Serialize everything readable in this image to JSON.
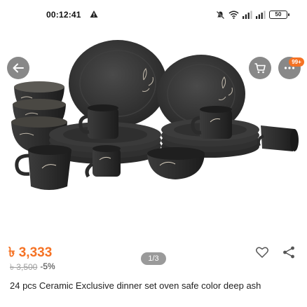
{
  "status_bar": {
    "time": "00:12:41",
    "battery": "50",
    "icons": [
      "warning-icon",
      "mute-icon",
      "wifi-icon",
      "signal-icon",
      "signal-icon",
      "battery-icon"
    ]
  },
  "top_nav": {
    "back_icon": "arrow-left-icon",
    "cart_icon": "cart-icon",
    "more_icon": "more-icon",
    "badge": "99+"
  },
  "gallery": {
    "pager": "1/3"
  },
  "product": {
    "price": "৳ 3,333",
    "original_price": "৳ 3,500",
    "discount": "-5%",
    "title": "24 pcs Ceramic Exclusive  dinner set oven safe color deep ash"
  },
  "actions": {
    "wishlist_icon": "heart-icon",
    "share_icon": "share-icon"
  },
  "colors": {
    "accent": "#f57224",
    "overlay_button": "#6e6e6e",
    "ceramic": "#2f2f2f"
  }
}
